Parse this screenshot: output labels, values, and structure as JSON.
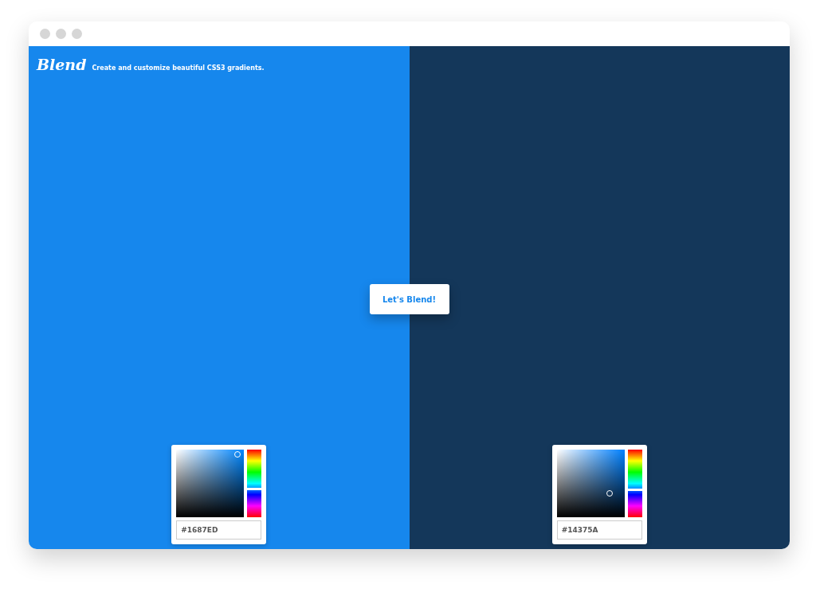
{
  "header": {
    "logo": "Blend",
    "tagline": "Create and customize beautiful CSS3 gradients."
  },
  "panels": [
    {
      "color": "#1687ed",
      "hex": "#1687ED"
    },
    {
      "color": "#14375a",
      "hex": "#14375A"
    }
  ],
  "button": "Let's Blend!"
}
